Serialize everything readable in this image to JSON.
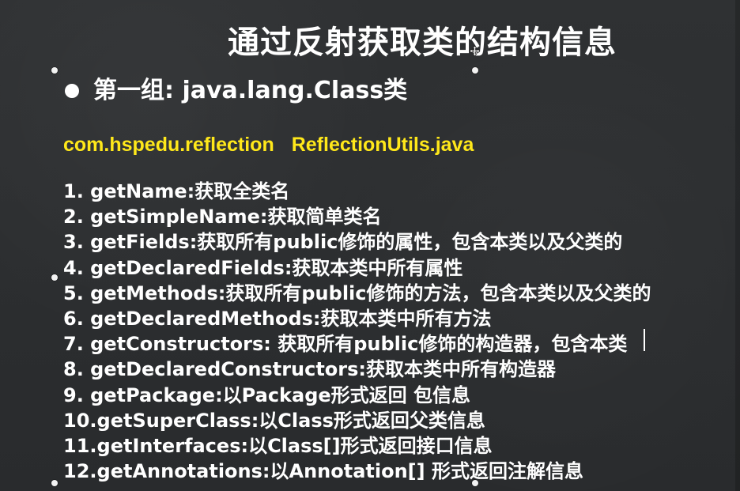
{
  "slide": {
    "title": "通过反射获取类的结构信息",
    "section_title": "第一组: java.lang.Class类",
    "package_name": "com.hspedu.reflection",
    "file_name": "ReflectionUtils.java",
    "items": [
      "1.  getName:获取全类名",
      "2.  getSimpleName:获取简单类名",
      "3.  getFields:获取所有public修饰的属性，包含本类以及父类的",
      "4.  getDeclaredFields:获取本类中所有属性",
      "5.  getMethods:获取所有public修饰的方法，包含本类以及父类的",
      "6.  getDeclaredMethods:获取本类中所有方法",
      "7.  getConstructors: 获取所有public修饰的构造器，包含本类",
      "8.  getDeclaredConstructors:获取本类中所有构造器",
      "9.  getPackage:以Package形式返回 包信息",
      "10.getSuperClass:以Class形式返回父类信息",
      "11.getInterfaces:以Class[]形式返回接口信息",
      "12.getAnnotations:以Annotation[] 形式返回注解信息"
    ]
  },
  "colors": {
    "background": "#2b2d2f",
    "text": "#ffffff",
    "highlight": "#ffe81a"
  }
}
